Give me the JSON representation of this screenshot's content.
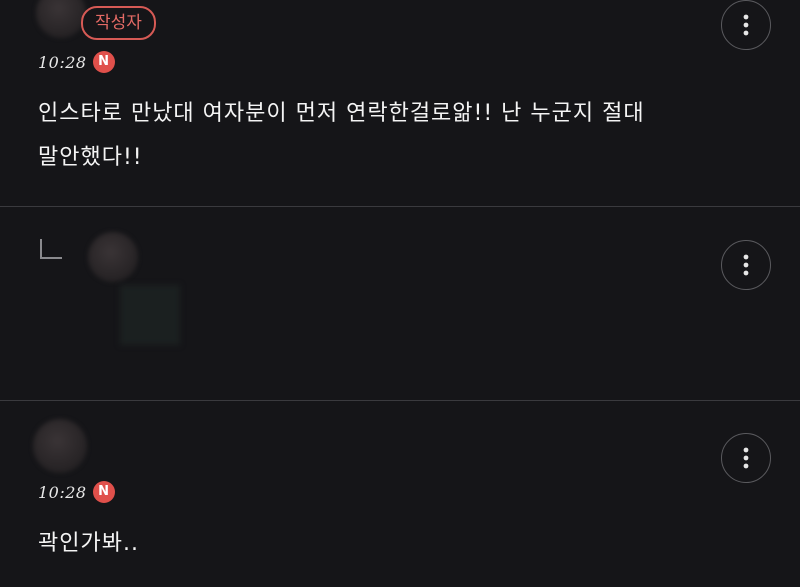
{
  "comments": [
    {
      "author_badge": "작성자",
      "time": "10:28",
      "new_badge": "N",
      "body": "인스타로 만났대 여자분이 먼저 연락한걸로앎!! 난 누군지 절대\n말안했다!!"
    },
    {
      "hidden": true
    },
    {
      "time": "10:28",
      "new_badge": "N",
      "body": "곽인가봐.."
    }
  ],
  "icons": {
    "more": "more-vertical-icon",
    "reply": "reply-arrow-icon",
    "new": "new-badge-icon"
  },
  "colors": {
    "background": "#151518",
    "accent_red": "#e0504b",
    "divider": "#3a3a3e",
    "text": "#f4f4f4"
  }
}
